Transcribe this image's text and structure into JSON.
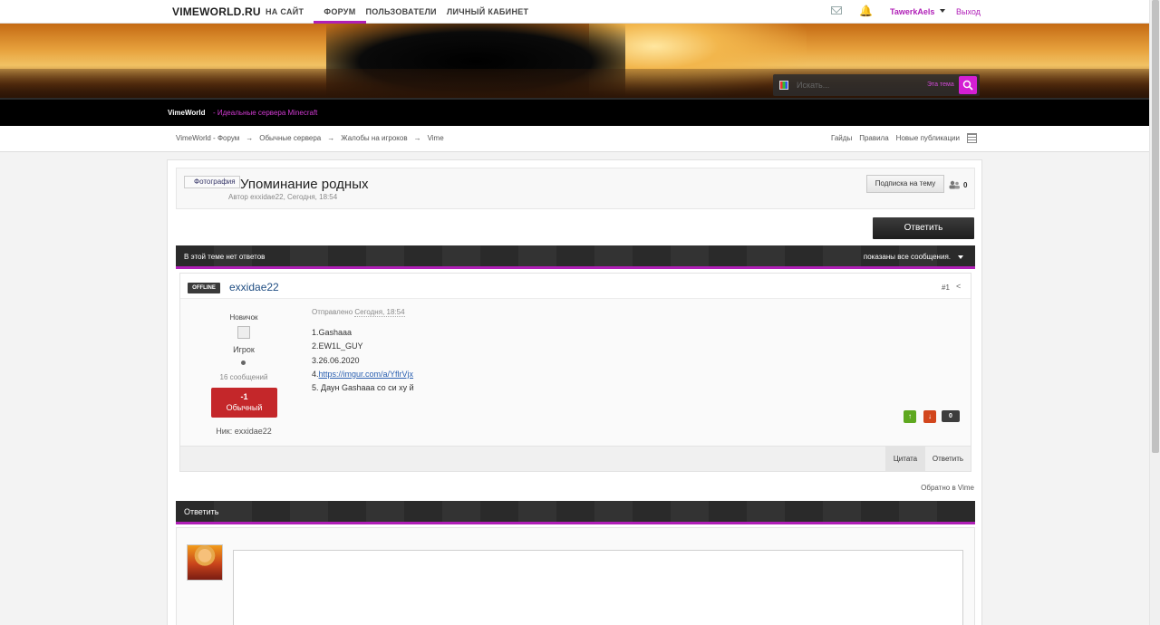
{
  "topbar": {
    "logo": "VIMEWORLD.RU",
    "nav": [
      "НА САЙТ",
      "ФОРУМ",
      "ПОЛЬЗОВАТЕЛИ",
      "ЛИЧНЫЙ КАБИНЕТ"
    ],
    "active_nav": "ФОРУМ",
    "username": "TawerkAels",
    "logout": "Выход"
  },
  "search": {
    "placeholder": "Искать...",
    "scope": "Эта тема"
  },
  "tagline": {
    "site": "VimeWorld",
    "sep_desc": " - Идеальные сервера Minecraft"
  },
  "breadcrumb": [
    "VimeWorld - Форум",
    "Обычные сервера",
    "Жалобы на игроков",
    "Vime"
  ],
  "breadcrumb_sep": "→",
  "right_links": [
    "Гайды",
    "Правила",
    "Новые публикации"
  ],
  "topic": {
    "photo_alt": "Фотография",
    "title": "Упоминание родных",
    "author_line": "Автор exxidae22, Сегодня, 18:54",
    "subscribe": "Подписка на тему",
    "followers": "0"
  },
  "reply_button": "Ответить",
  "thread_bar": {
    "left": "В этой теме нет ответов",
    "right": "показаны все сообщения."
  },
  "post": {
    "status": "OFFLINE",
    "username": "exxidae22",
    "number": "#1",
    "rank": "Новичок",
    "group": "Игрок",
    "posts": "16 сообщений",
    "rep_value": "-1",
    "rep_name": "Обычный",
    "nick": "Ник: exxidae22",
    "sent_prefix": "Отправлено ",
    "sent_time": "Сегодня, 18:54",
    "line1": "1.Gashaaa",
    "line2": "2.EW1L_GUY",
    "line3": "3.26.06.2020",
    "line4_prefix": "4.",
    "line4_link": "https://imgur.com/a/YflrVjx",
    "line5": "5. Даун Gashaaa со си ху й",
    "vote_count": "0",
    "quote": "Цитата",
    "reply": "Ответить"
  },
  "back_link": "Обратно в Vime",
  "reply_bar": "Ответить",
  "colors": {
    "accent": "#b01fb7",
    "dark_bar": "#2f2f2f",
    "rep_negative": "#c4272a"
  }
}
